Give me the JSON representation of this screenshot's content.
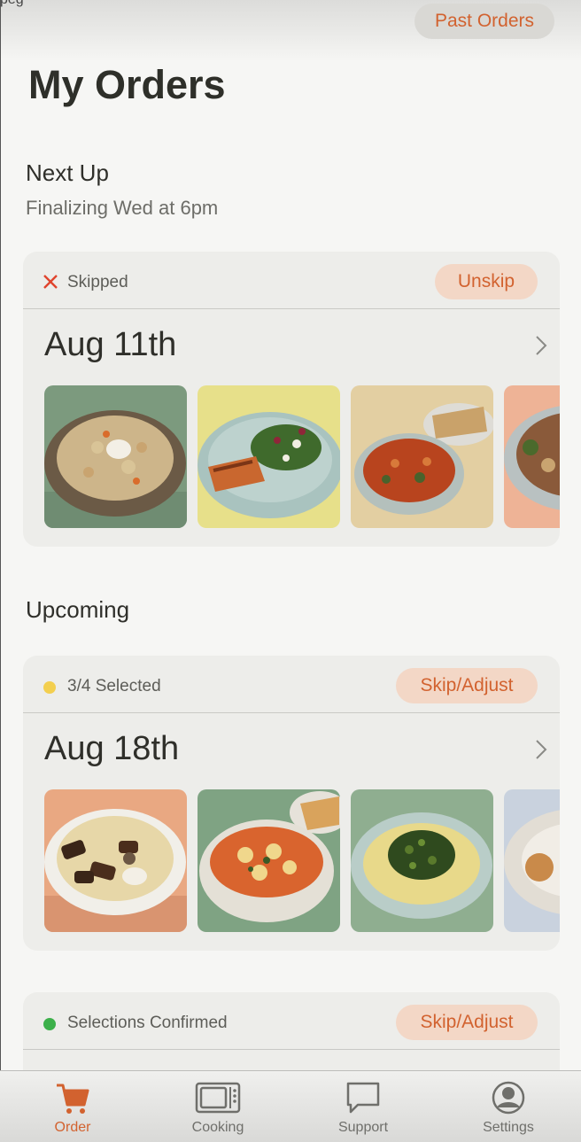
{
  "header": {
    "frag_text": "peg",
    "past_orders_label": "Past Orders",
    "title": "My Orders"
  },
  "next_up": {
    "heading": "Next Up",
    "subheading": "Finalizing Wed at 6pm",
    "card": {
      "status": "Skipped",
      "status_color": "#e0442d",
      "action_label": "Unskip",
      "date": "Aug 11th"
    }
  },
  "upcoming": {
    "heading": "Upcoming",
    "cards": [
      {
        "status": "3/4 Selected",
        "status_color": "#f3cf4f",
        "action_label": "Skip/Adjust",
        "date": "Aug 18th"
      },
      {
        "status": "Selections Confirmed",
        "status_color": "#3cb04a",
        "action_label": "Skip/Adjust"
      }
    ]
  },
  "tabs": [
    {
      "label": "Order",
      "icon": "cart-icon",
      "active": true
    },
    {
      "label": "Cooking",
      "icon": "microwave-icon",
      "active": false
    },
    {
      "label": "Support",
      "icon": "chat-bubble-icon",
      "active": false
    },
    {
      "label": "Settings",
      "icon": "user-circle-icon",
      "active": false
    }
  ],
  "colors": {
    "accent": "#d2622f",
    "pill_bg": "#f3d7c6",
    "card_bg": "#ededea"
  }
}
